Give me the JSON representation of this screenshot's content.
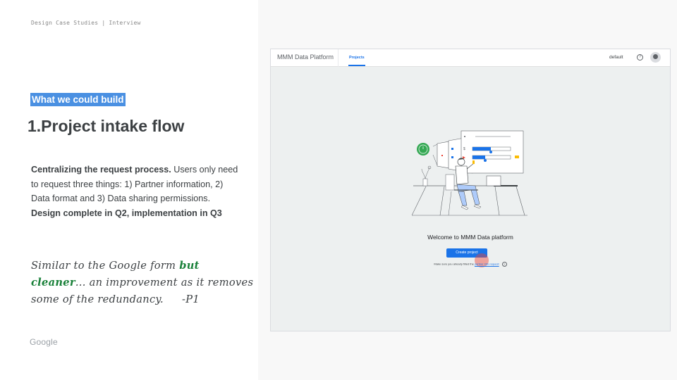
{
  "breadcrumb": "Design Case Studies | Interview",
  "tag": "What we could build",
  "title": "1.Project intake flow",
  "body": {
    "bold1": "Centralizing the request process.",
    "text1": " Users only need to request three things: 1) Partner information, 2) Data format and 3) Data sharing permissions.",
    "bold2": "Design complete in Q2, implementation in Q3"
  },
  "quote": {
    "part1": "Similar to the Google form ",
    "highlight": "but cleaner",
    "part2": "... an improvement as it removes some of the redundancy.",
    "attribution": "-P1"
  },
  "footer_logo": "Google",
  "app": {
    "title": "MMM Data Platform",
    "tab": "Projects",
    "profile": "default",
    "help_icon": "?",
    "welcome": "Welcome to MMM Data platform",
    "create_button": "Create project",
    "note_prefix": "Make sure you already filled the ",
    "note_link": "partner info request",
    "colors": {
      "accent": "#1a73e8",
      "tag_bg": "#4a90e2",
      "quote_highlight": "#188038"
    }
  }
}
